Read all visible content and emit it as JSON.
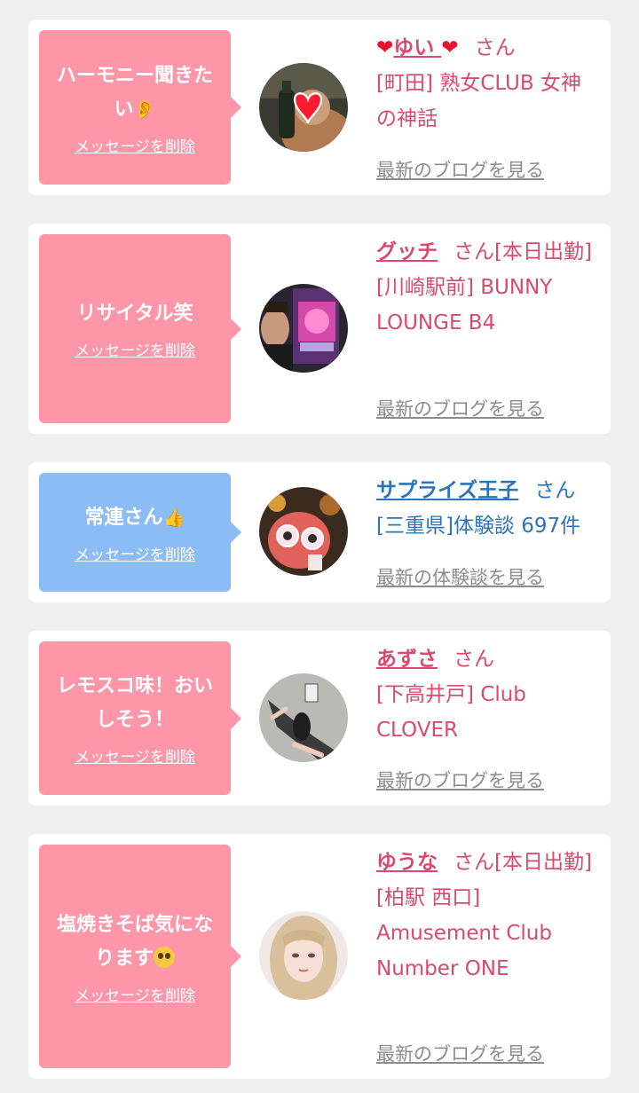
{
  "cards": [
    {
      "message": "ハーモニー聞きたい",
      "message_emoji": "ear-emoji",
      "delete_label": "メッセージを削除",
      "name_prefix_icon": "heart-icon",
      "name": "ゆい",
      "name_suffix_icon": "heart-icon",
      "honorific": "さん",
      "status": "",
      "shop": "[町田] 熟女CLUB 女神の神話",
      "link": "最新のブログを見る",
      "bubble_color": "#fd96a9",
      "accent_color": "#d94a6c"
    },
    {
      "message": "リサイタル笑",
      "delete_label": "メッセージを削除",
      "name": "グッチ",
      "honorific": "さん",
      "status": "[本日出勤]",
      "shop": "[川崎駅前] BUNNY LOUNGE B4",
      "link": "最新のブログを見る",
      "bubble_color": "#fd96a9",
      "accent_color": "#d94a6c"
    },
    {
      "message": "常連さん",
      "message_emoji": "thumbs-up-emoji",
      "delete_label": "メッセージを削除",
      "name": "サプライズ王子",
      "honorific": "さん",
      "status": "",
      "shop": "[三重県]体験談 697件",
      "link": "最新の体験談を見る",
      "bubble_color": "#8bbcf5",
      "accent_color": "#2b74b8"
    },
    {
      "message": "レモスコ味！おいしそう！",
      "delete_label": "メッセージを削除",
      "name": "あずさ",
      "honorific": "さん",
      "status": "",
      "shop": "[下高井戸] Club CLOVER",
      "link": "最新のブログを見る",
      "bubble_color": "#fd96a9",
      "accent_color": "#d94a6c"
    },
    {
      "message": "塩焼きそば気になります",
      "message_emoji": "pleading-face-emoji",
      "delete_label": "メッセージを削除",
      "name": "ゆうな",
      "honorific": "さん",
      "status": "[本日出勤]",
      "shop": "[柏駅 西口] Amusement Club Number ONE",
      "link": "最新のブログを見る",
      "bubble_color": "#fd96a9",
      "accent_color": "#d94a6c"
    }
  ]
}
